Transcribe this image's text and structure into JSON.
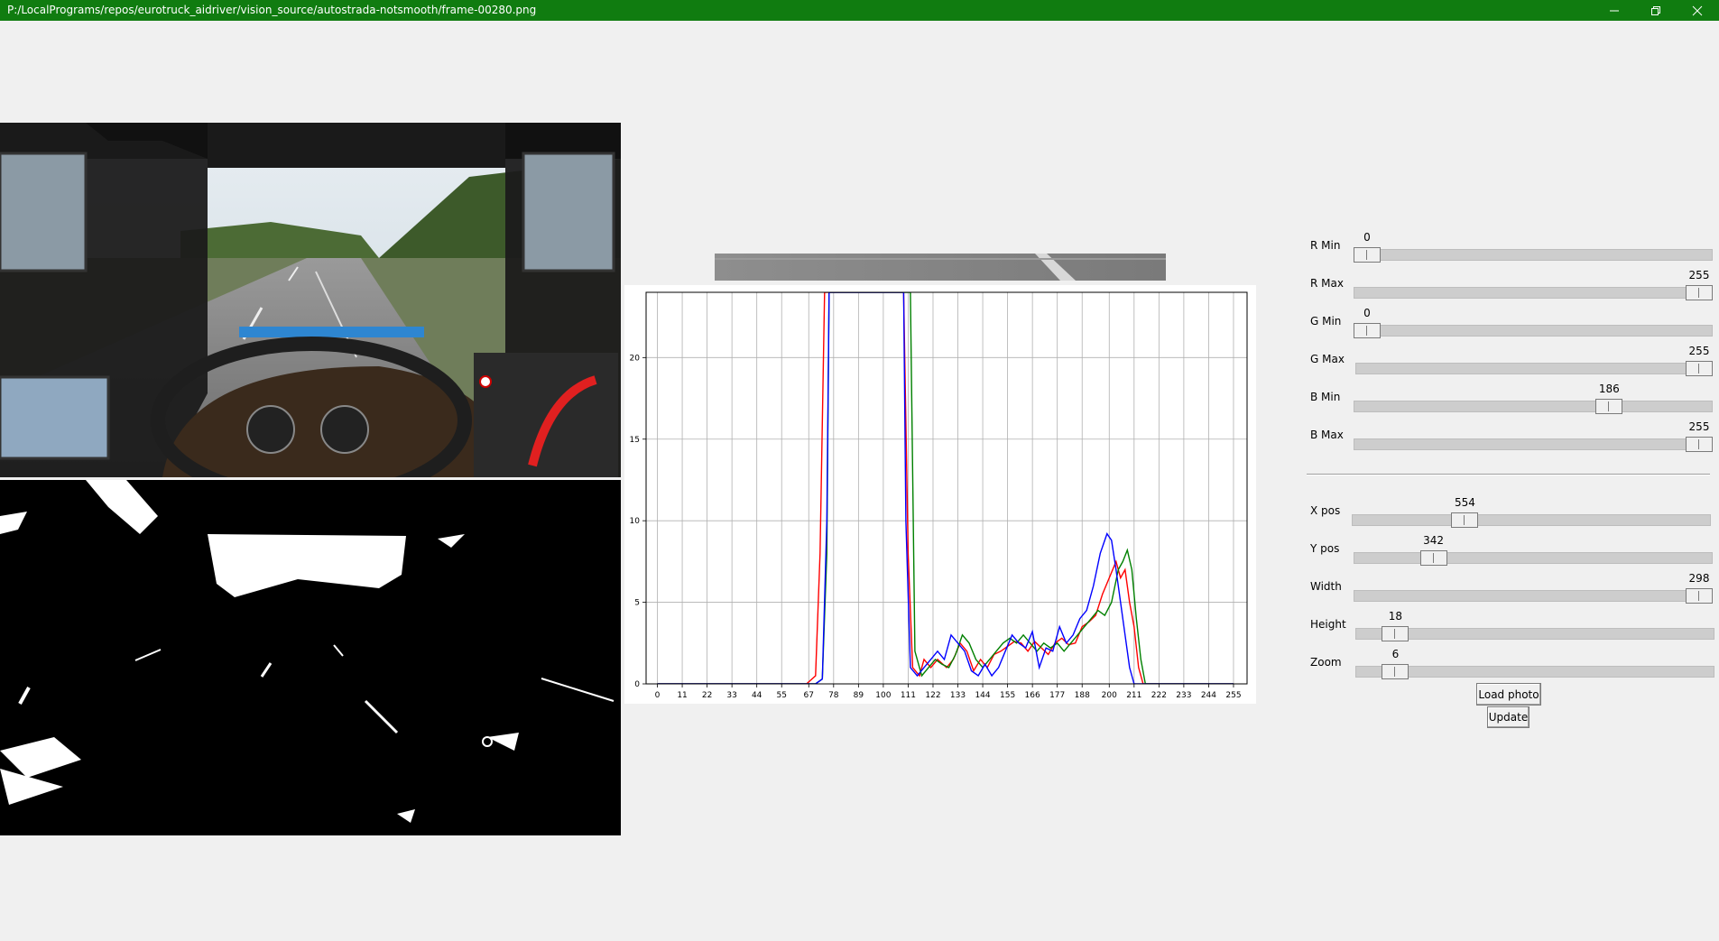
{
  "window": {
    "title": "P:/LocalPrograms/repos/eurotruck_aidriver/vision_source/autostrada-notsmooth/frame-00280.png",
    "controls": [
      "minimize-icon",
      "restore-icon",
      "close-icon"
    ]
  },
  "sliders": [
    {
      "label": "R Min",
      "value": "0",
      "fraction": 0.0
    },
    {
      "label": "R Max",
      "value": "255",
      "fraction": 1.0
    },
    {
      "label": "G Min",
      "value": "0",
      "fraction": 0.0
    },
    {
      "label": "G Max",
      "value": "255",
      "fraction": 1.0
    },
    {
      "label": "B Min",
      "value": "186",
      "fraction": 0.729
    },
    {
      "label": "B Max",
      "value": "255",
      "fraction": 1.0
    },
    {
      "label": "X pos",
      "value": "554",
      "fraction": 0.3
    },
    {
      "label": "Y pos",
      "value": "342",
      "fraction": 0.2
    },
    {
      "label": "Width",
      "value": "298",
      "fraction": 1.0
    },
    {
      "label": "Height",
      "value": "18",
      "fraction": 0.08
    },
    {
      "label": "Zoom",
      "value": "6",
      "fraction": 0.08
    }
  ],
  "buttons": {
    "load": "Load photo",
    "update": "Update"
  },
  "chart_data": {
    "type": "line",
    "xlim": [
      -5,
      261
    ],
    "ylim": [
      0,
      24
    ],
    "xticks": [
      0,
      11,
      22,
      33,
      44,
      55,
      67,
      78,
      89,
      100,
      111,
      122,
      133,
      144,
      155,
      166,
      177,
      188,
      200,
      211,
      222,
      233,
      244,
      255
    ],
    "yticks": [
      0,
      5,
      10,
      15,
      20
    ],
    "grid": true,
    "series": [
      {
        "color": "#ff0000",
        "points": [
          [
            0,
            0
          ],
          [
            66,
            0
          ],
          [
            70,
            0.5
          ],
          [
            72,
            8
          ],
          [
            74,
            24
          ],
          [
            109,
            24
          ],
          [
            111,
            8
          ],
          [
            113,
            1
          ],
          [
            116,
            0.5
          ],
          [
            118,
            1.5
          ],
          [
            121,
            1
          ],
          [
            124,
            1.5
          ],
          [
            128,
            1
          ],
          [
            131,
            1.5
          ],
          [
            134,
            2.5
          ],
          [
            137,
            2
          ],
          [
            140,
            0.8
          ],
          [
            143,
            1.5
          ],
          [
            146,
            1
          ],
          [
            149,
            1.8
          ],
          [
            152,
            2
          ],
          [
            155,
            2.3
          ],
          [
            158,
            2.6
          ],
          [
            161,
            2.5
          ],
          [
            164,
            2
          ],
          [
            167,
            2.6
          ],
          [
            170,
            2.2
          ],
          [
            173,
            1.8
          ],
          [
            176,
            2.5
          ],
          [
            179,
            2.8
          ],
          [
            182,
            2.4
          ],
          [
            185,
            2.5
          ],
          [
            188,
            3.5
          ],
          [
            191,
            3.8
          ],
          [
            194,
            4.2
          ],
          [
            197,
            5.5
          ],
          [
            200,
            6.5
          ],
          [
            203,
            7.5
          ],
          [
            205,
            6.5
          ],
          [
            207,
            7
          ],
          [
            209,
            5
          ],
          [
            211,
            3.5
          ],
          [
            213,
            1
          ],
          [
            215,
            0
          ],
          [
            255,
            0
          ]
        ]
      },
      {
        "color": "#008000",
        "points": [
          [
            0,
            0
          ],
          [
            70,
            0
          ],
          [
            73,
            0.3
          ],
          [
            75,
            8
          ],
          [
            76,
            24
          ],
          [
            112,
            24
          ],
          [
            114,
            2
          ],
          [
            117,
            0.5
          ],
          [
            120,
            1
          ],
          [
            123,
            1.5
          ],
          [
            126,
            1.2
          ],
          [
            129,
            1
          ],
          [
            132,
            1.8
          ],
          [
            135,
            3
          ],
          [
            138,
            2.5
          ],
          [
            141,
            1.5
          ],
          [
            144,
            1
          ],
          [
            147,
            1.5
          ],
          [
            150,
            2
          ],
          [
            153,
            2.5
          ],
          [
            156,
            2.8
          ],
          [
            159,
            2.5
          ],
          [
            162,
            3
          ],
          [
            165,
            2.5
          ],
          [
            168,
            2
          ],
          [
            171,
            2.5
          ],
          [
            174,
            2.2
          ],
          [
            177,
            2.5
          ],
          [
            180,
            2
          ],
          [
            183,
            2.5
          ],
          [
            186,
            3
          ],
          [
            189,
            3.5
          ],
          [
            192,
            4
          ],
          [
            195,
            4.5
          ],
          [
            198,
            4.2
          ],
          [
            201,
            5
          ],
          [
            204,
            7
          ],
          [
            206,
            7.5
          ],
          [
            208,
            8.2
          ],
          [
            210,
            7
          ],
          [
            212,
            4
          ],
          [
            214,
            1.5
          ],
          [
            216,
            0
          ],
          [
            255,
            0
          ]
        ]
      },
      {
        "color": "#0000ff",
        "points": [
          [
            0,
            0
          ],
          [
            70,
            0
          ],
          [
            73,
            0.3
          ],
          [
            75,
            10
          ],
          [
            76,
            24
          ],
          [
            109,
            24
          ],
          [
            110,
            10
          ],
          [
            112,
            1
          ],
          [
            115,
            0.5
          ],
          [
            118,
            1
          ],
          [
            121,
            1.5
          ],
          [
            124,
            2
          ],
          [
            127,
            1.5
          ],
          [
            130,
            3
          ],
          [
            133,
            2.5
          ],
          [
            136,
            2
          ],
          [
            139,
            0.8
          ],
          [
            142,
            0.5
          ],
          [
            145,
            1.2
          ],
          [
            148,
            0.5
          ],
          [
            151,
            1
          ],
          [
            154,
            2
          ],
          [
            157,
            3
          ],
          [
            160,
            2.5
          ],
          [
            163,
            2.2
          ],
          [
            166,
            3.2
          ],
          [
            169,
            1
          ],
          [
            172,
            2.2
          ],
          [
            175,
            2
          ],
          [
            178,
            3.5
          ],
          [
            181,
            2.5
          ],
          [
            184,
            3
          ],
          [
            187,
            4
          ],
          [
            190,
            4.5
          ],
          [
            193,
            6
          ],
          [
            196,
            8
          ],
          [
            199,
            9.2
          ],
          [
            201,
            8.8
          ],
          [
            203,
            7
          ],
          [
            205,
            5
          ],
          [
            207,
            3
          ],
          [
            209,
            1
          ],
          [
            211,
            0
          ],
          [
            255,
            0
          ]
        ]
      }
    ]
  }
}
